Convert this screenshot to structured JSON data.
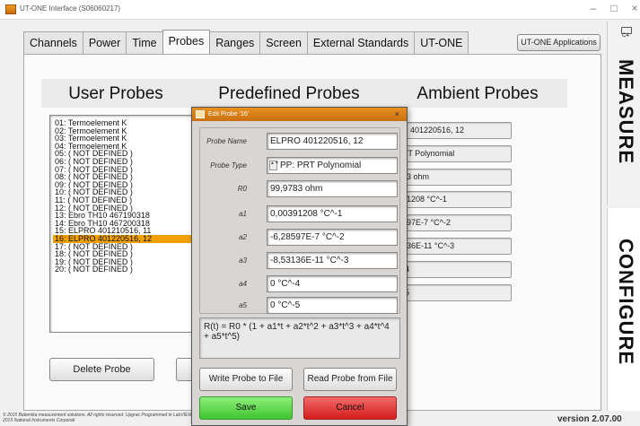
{
  "window": {
    "title": "UT-ONE Interface (S06060217)",
    "minimize": "–",
    "maximize": "□",
    "close": "×"
  },
  "tabs": [
    {
      "label": "Channels"
    },
    {
      "label": "Power"
    },
    {
      "label": "Time"
    },
    {
      "label": "Probes"
    },
    {
      "label": "Ranges"
    },
    {
      "label": "Screen"
    },
    {
      "label": "External Standards"
    },
    {
      "label": "UT-ONE"
    }
  ],
  "active_tab": "Probes",
  "apps_button": "UT-ONE Applications",
  "sections": {
    "user": "User Probes",
    "predefined": "Predefined Probes",
    "ambient": "Ambient Probes"
  },
  "user_probes": [
    "01: Termoelement K",
    "02: Termoelement K",
    "03: Termoelement K",
    "04: Termoelement K",
    "05: ( NOT DEFINED )",
    "06: ( NOT DEFINED )",
    "07: ( NOT DEFINED )",
    "08: ( NOT DEFINED )",
    "09: ( NOT DEFINED )",
    "10: ( NOT DEFINED )",
    "11: ( NOT DEFINED )",
    "12: ( NOT DEFINED )",
    "13: Ebro TH10 467190318",
    "14: Ebro TH10 467200318",
    "15: ELPRO 401210516, 11",
    "16: ELPRO 401220516, 12",
    "17: ( NOT DEFINED )",
    "18: ( NOT DEFINED )",
    "19: ( NOT DEFINED )",
    "20: ( NOT DEFINED )"
  ],
  "selected_probe": "16: ELPRO 401220516, 12",
  "delete_button": "Delete Probe",
  "ambient_fields": [
    "D 401220516, 12",
    "RT Polynomial",
    "83 ohm",
    "91208 °C^-1",
    "597E-7 °C^-2",
    "136E-11 °C^-3",
    "-4",
    "-5"
  ],
  "side": {
    "measure": "MEASURE",
    "configure": "CONFIGURE",
    "c4": "C4"
  },
  "footer": {
    "copyright": "© 2015 Batemika measurement solutions. All rights reserved. Upgrac Programmed in LabVIEW™. © 2015 National Instruments Corporati",
    "version": "version 2.07.00"
  },
  "dialog": {
    "title": "Edit Probe '16'",
    "close": "×",
    "fields": {
      "probe_name": {
        "label": "Probe Name",
        "value": "ELPRO 401220516, 12"
      },
      "probe_type": {
        "label": "Probe Type",
        "value": "PP: PRT Polynomial"
      },
      "r0": {
        "label": "R0",
        "value": "99,9783 ohm"
      },
      "a1": {
        "label": "a1",
        "value": "0,00391208 °C^-1"
      },
      "a2": {
        "label": "a2",
        "value": "-6,28597E-7 °C^-2"
      },
      "a3": {
        "label": "a3",
        "value": "-8,53136E-11 °C^-3"
      },
      "a4": {
        "label": "a4",
        "value": "0 °C^-4"
      },
      "a5": {
        "label": "a5",
        "value": "0 °C^-5"
      }
    },
    "formula": "R(t) = R0 * (1 + a1*t + a2*t^2 + a3*t^3 + a4*t^4 + a5*t^5)",
    "write_button": "Write Probe to File",
    "read_button": "Read Probe from File",
    "save_button": "Save",
    "cancel_button": "Cancel"
  },
  "colors": {
    "accent": "#f0a000",
    "save": "#4cd040",
    "cancel": "#e02828"
  }
}
